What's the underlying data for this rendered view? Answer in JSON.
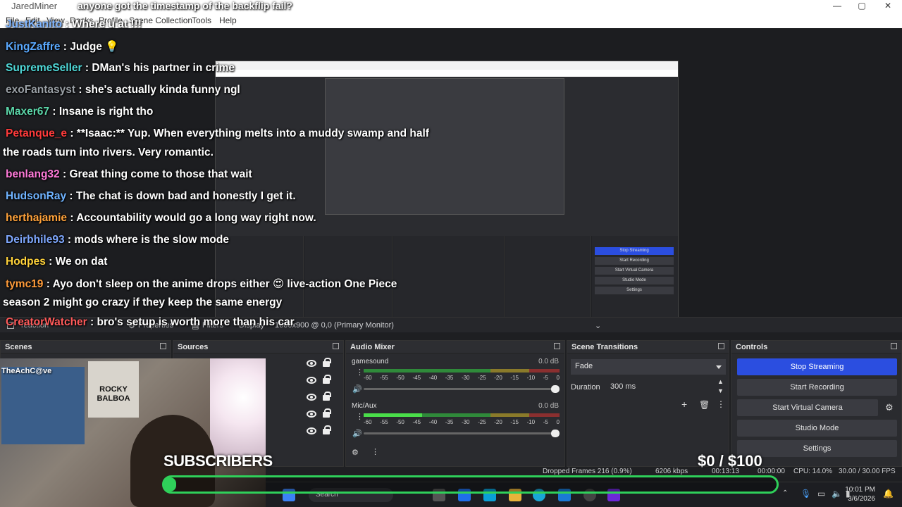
{
  "window": {
    "title": "JaredMiner",
    "controls": [
      "—",
      "▢",
      "✕"
    ]
  },
  "menu": [
    "File",
    "Edit",
    "View",
    "Docks",
    "Profile",
    "Scene Collection",
    "Tools",
    "Help"
  ],
  "chat": [
    {
      "user": "JustKanito",
      "color": "#7fb5ff",
      "msg": "Where u at !!!"
    },
    {
      "user": "KingZaffre",
      "color": "#5aa9ff",
      "msg": "Judge 💡"
    },
    {
      "user": "SupremeSeller",
      "color": "#4fd8d8",
      "msg": "DMan's his partner in crime"
    },
    {
      "user": "exoFantasyst",
      "color": "#9aa0a6",
      "msg": "she's actually kinda funny ngl"
    },
    {
      "user": "Maxer67",
      "color": "#5cd6a9",
      "msg": "Insane is right tho"
    },
    {
      "user": "Petanque_e",
      "color": "#ff3b3b",
      "msg": "**Isaac:** Yup. When everything melts into a muddy swamp and half"
    },
    {
      "user": "",
      "color": "#ffffff",
      "msg": "the roads turn into rivers. Very romantic."
    },
    {
      "user": "benlang32",
      "color": "#ff7ad9",
      "msg": "Great thing come to those that wait"
    },
    {
      "user": "HudsonRay",
      "color": "#6fb3ff",
      "msg": "The chat is down bad and honestly I get it."
    },
    {
      "user": "herthajamie",
      "color": "#ffa23a",
      "msg": "Accountability would go a long way right now."
    },
    {
      "user": "Deirbhile93",
      "color": "#7fa8ff",
      "msg": "mods where is the slow mode"
    },
    {
      "user": "Hodpes",
      "color": "#ffd23a",
      "msg": "We on dat"
    },
    {
      "user": "tymc19",
      "color": "#ff9b3a",
      "msg": "Ayo don't sleep on the anime drops either 😍 live-action One Piece"
    },
    {
      "user": "",
      "color": "#ffffff",
      "msg": "season 2 might go crazy if they keep the same energy"
    },
    {
      "user": "CreatorWatcher",
      "color": "#ff5a5a",
      "msg": "bro's setup is worth more than his car"
    }
  ],
  "chat_header_overlay": "anyone got the timestamp of the backflip fail?",
  "propstrip": {
    "reaction": "reaction",
    "properties": "Properties",
    "filters": "Filters",
    "display": "Display",
    "monitor": "1600x900 @ 0,0 (Primary Monitor)"
  },
  "docks": {
    "scenes": "Scenes",
    "sources": "Sources",
    "mixer": "Audio Mixer",
    "transitions": "Scene Transitions",
    "controls": "Controls"
  },
  "mixer": {
    "channels": [
      {
        "name": "gamesound",
        "db": "0.0 dB",
        "level": 0.0
      },
      {
        "name": "Mic/Aux",
        "db": "0.0 dB",
        "level": 0.3
      }
    ],
    "scale": [
      "-60",
      "-55",
      "-50",
      "-45",
      "-40",
      "-35",
      "-30",
      "-25",
      "-20",
      "-15",
      "-10",
      "-5",
      "0"
    ]
  },
  "transitions": {
    "selected": "Fade",
    "duration_label": "Duration",
    "duration_value": "300 ms"
  },
  "controls": {
    "stop_streaming": "Stop Streaming",
    "start_recording": "Start Recording",
    "start_virtual_camera": "Start Virtual Camera",
    "studio_mode": "Studio Mode",
    "settings": "Settings"
  },
  "status": {
    "dropped": "Dropped Frames 216 (0.9%)",
    "kbps": "6206 kbps",
    "live": "00:13:13",
    "rec": "00:00:00",
    "cpu": "CPU: 14.0%",
    "fps": "30.00 / 30.00 FPS"
  },
  "overlay": {
    "webcam_tag": "TheAchC@ve",
    "poster_text": "ROCKY BALBOA",
    "subscribers": "SUBSCRIBERS",
    "goal_text": "$0 / $100",
    "goal_progress": 0.02
  },
  "taskbar": {
    "search": "Search",
    "time": "10:01 PM",
    "date": "3/6/2026"
  },
  "colors": {
    "accent": "#2b4ee0",
    "goal_green": "#2fd05a"
  }
}
